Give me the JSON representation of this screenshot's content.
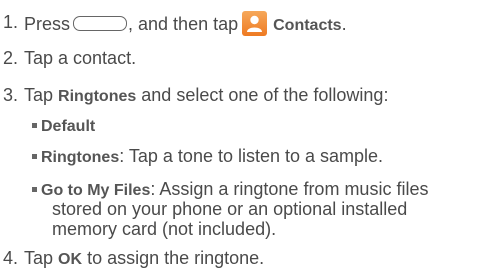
{
  "steps": [
    {
      "num": "1.",
      "pre": "Press",
      "mid": ", and then tap",
      "bold": "Contacts",
      "post": "."
    },
    {
      "num": "2.",
      "text": "Tap a contact."
    },
    {
      "num": "3.",
      "pre": "Tap",
      "bold": "Ringtones",
      "post": "and select one of the following:",
      "options": [
        {
          "label": "Default",
          "desc": ""
        },
        {
          "label": "Ringtones",
          "desc": ": Tap a tone to listen to a sample."
        },
        {
          "label": "Go to My Files",
          "desc": ": Assign a ringtone from music files",
          "cont": [
            "stored on your phone or an optional installed",
            "memory card (not included)."
          ]
        }
      ]
    },
    {
      "num": "4.",
      "pre": "Tap",
      "bold": "OK",
      "post": "to assign the ringtone."
    }
  ],
  "icons": {
    "home_key": "home-key-icon",
    "contacts": "contacts-icon",
    "contacts_color": "#ee7a22"
  }
}
